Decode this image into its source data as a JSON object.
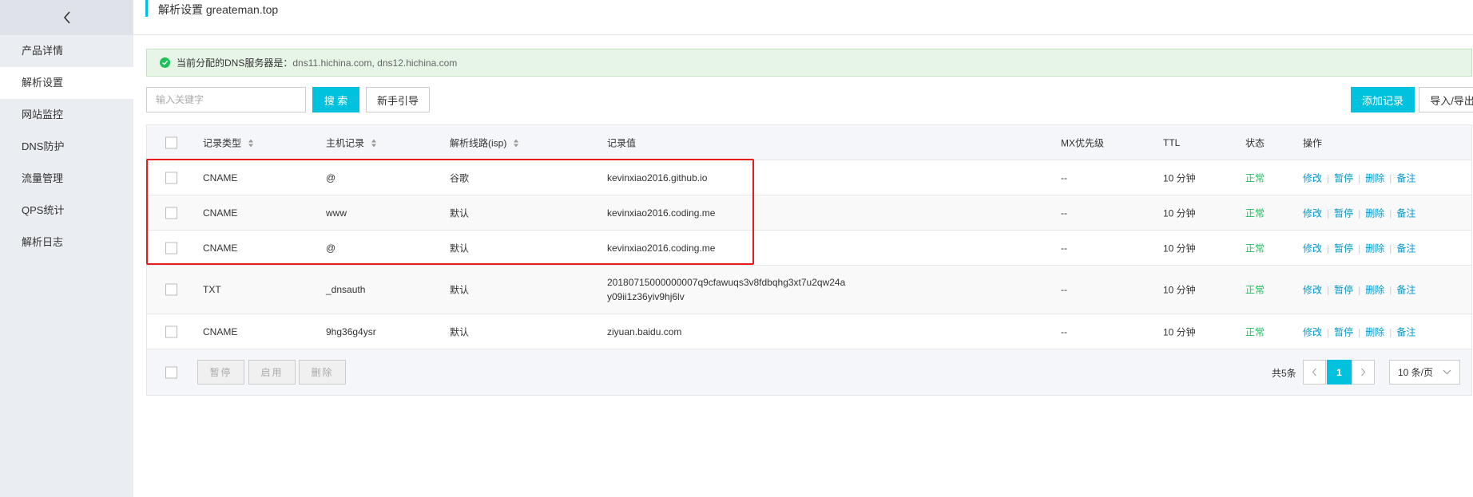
{
  "sidebar": {
    "back_icon": "chevron-left-icon",
    "items": [
      {
        "label": "产品详情",
        "active": false
      },
      {
        "label": "解析设置",
        "active": true
      },
      {
        "label": "网站监控",
        "active": false
      },
      {
        "label": "DNS防护",
        "active": false
      },
      {
        "label": "流量管理",
        "active": false
      },
      {
        "label": "QPS统计",
        "active": false
      },
      {
        "label": "解析日志",
        "active": false
      }
    ]
  },
  "header": {
    "title": "解析设置 greateman.top"
  },
  "notice": {
    "label": "当前分配的DNS服务器是：",
    "servers": "dns11.hichina.com, dns12.hichina.com"
  },
  "toolbar": {
    "search_placeholder": "输入关键字",
    "search_label": "搜 索",
    "guide_label": "新手引导",
    "add_label": "添加记录",
    "import_label": "导入/导出"
  },
  "table": {
    "headers": {
      "type": "记录类型",
      "host": "主机记录",
      "line": "解析线路(isp)",
      "value": "记录值",
      "mx": "MX优先级",
      "ttl": "TTL",
      "status": "状态",
      "ops": "操作"
    },
    "ops": {
      "edit": "修改",
      "pause": "暂停",
      "delete": "删除",
      "note": "备注"
    },
    "rows": [
      {
        "type": "CNAME",
        "host": "@",
        "line": "谷歌",
        "value": "kevinxiao2016.github.io",
        "value2": "",
        "mx": "--",
        "ttl": "10 分钟",
        "status": "正常"
      },
      {
        "type": "CNAME",
        "host": "www",
        "line": "默认",
        "value": "kevinxiao2016.coding.me",
        "value2": "",
        "mx": "--",
        "ttl": "10 分钟",
        "status": "正常"
      },
      {
        "type": "CNAME",
        "host": "@",
        "line": "默认",
        "value": "kevinxiao2016.coding.me",
        "value2": "",
        "mx": "--",
        "ttl": "10 分钟",
        "status": "正常"
      },
      {
        "type": "TXT",
        "host": "_dnsauth",
        "line": "默认",
        "value": "20180715000000007q9cfawuqs3v8fdbqhg3xt7u2qw24a",
        "value2": "y09ii1z36yiv9hj6lv",
        "mx": "--",
        "ttl": "10 分钟",
        "status": "正常"
      },
      {
        "type": "CNAME",
        "host": "9hg36g4ysr",
        "line": "默认",
        "value": "ziyuan.baidu.com",
        "value2": "",
        "mx": "--",
        "ttl": "10 分钟",
        "status": "正常"
      }
    ]
  },
  "footer": {
    "pause_label": "暂停",
    "enable_label": "启用",
    "delete_label": "删除",
    "total": "共5条",
    "current_page": "1",
    "page_size": "10 条/页"
  },
  "colors": {
    "accent": "#00c1de",
    "status_ok": "#1fbf5a",
    "link": "#0099cc",
    "highlight": "#e81a1a"
  }
}
